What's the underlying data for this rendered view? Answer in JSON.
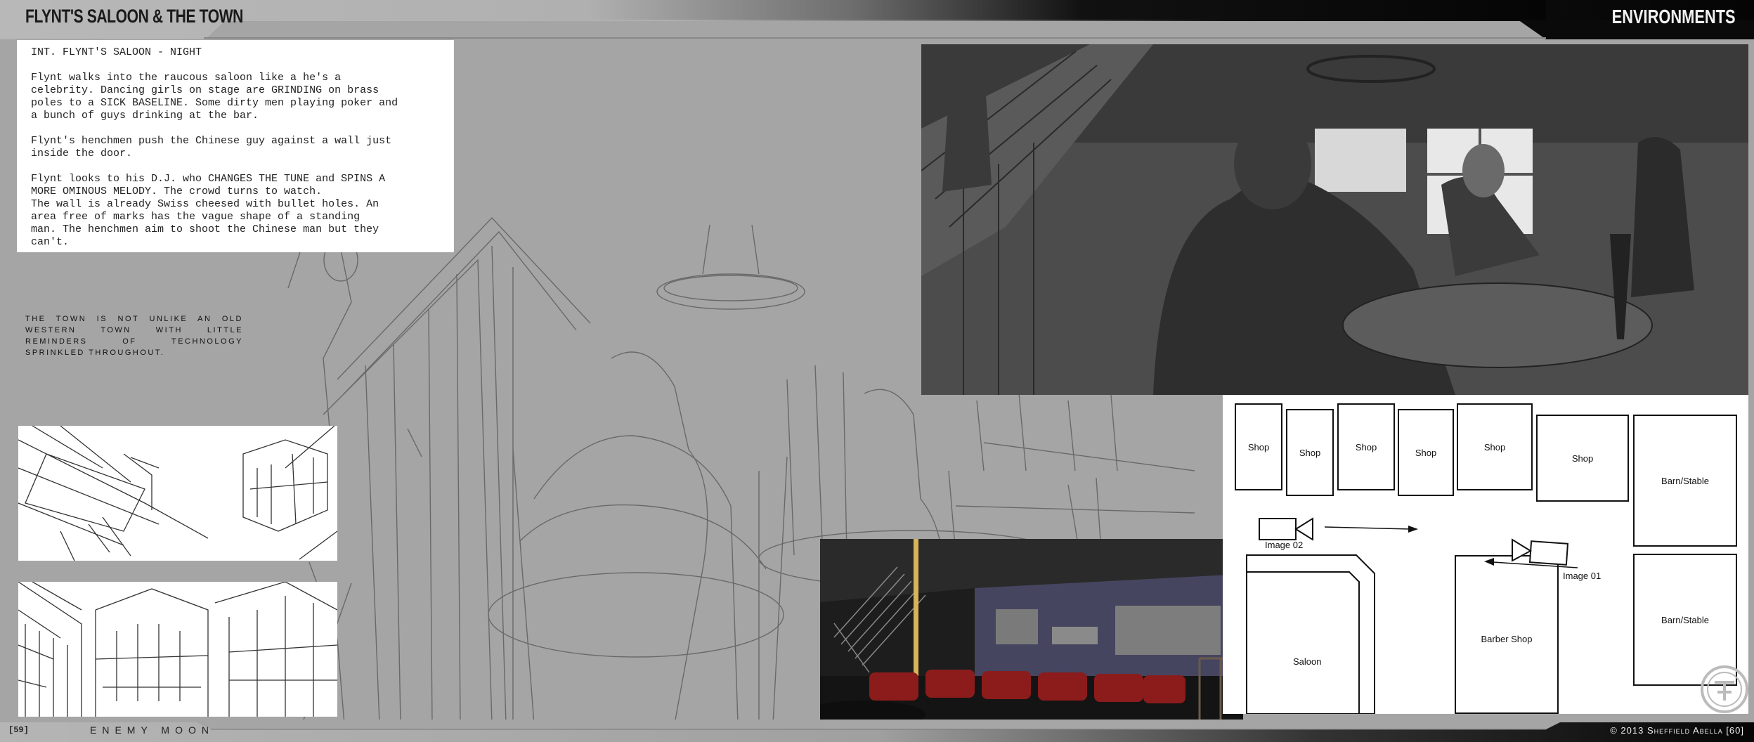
{
  "header": {
    "title_left": "FLYNT'S SALOON & THE TOWN",
    "title_right": "ENVIRONMENTS"
  },
  "script": {
    "heading": "INT. FLYNT'S SALOON - NIGHT",
    "paragraphs": [
      "Flynt walks into the raucous saloon like a he's a\ncelebrity. Dancing girls on stage are GRINDING on brass\npoles to a SICK BASELINE. Some dirty men playing poker and\na bunch of guys drinking at the bar.",
      "Flynt's henchmen push the Chinese guy against a wall just\ninside the door.",
      "Flynt looks to his D.J. who CHANGES THE TUNE and SPINS A\nMORE OMINOUS MELODY. The crowd turns to watch.\nThe wall is already Swiss cheesed with bullet holes. An\narea free of marks has the vague shape of a standing\nman. The henchmen aim to shoot the Chinese man but they\ncan't."
    ]
  },
  "town_note": "The town is not unlike an old western town with little reminders of technology sprinkled throughout.",
  "map": {
    "shops": [
      "Shop",
      "Shop",
      "Shop",
      "Shop",
      "Shop",
      "Shop"
    ],
    "barn_top": "Barn/Stable",
    "barn_bottom": "Barn/Stable",
    "saloon": "Saloon",
    "barber": "Barber Shop",
    "image02": "Image 02",
    "image01": "Image 01"
  },
  "footer": {
    "page_left": "[59]",
    "brand": "ENEMY MOON",
    "copyright": "© 2013 Sheffield Abella [60]"
  },
  "colors": {
    "background": "#a5a5a5",
    "header_dark": "#111111",
    "render_chairs": "#8c1c1c",
    "render_wall": "#454560"
  }
}
